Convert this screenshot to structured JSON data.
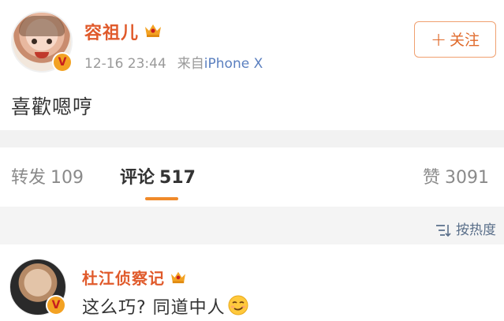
{
  "post": {
    "username": "容祖儿",
    "timestamp": "12-16 23:44",
    "source_prefix": "来自",
    "device": "iPhone X",
    "text": "喜歡嗯哼",
    "follow_label": "关注",
    "follow_plus": "+"
  },
  "tabs": [
    {
      "label": "转发",
      "count": "109"
    },
    {
      "label": "评论",
      "count": "517"
    },
    {
      "label": "赞",
      "count": "3091"
    }
  ],
  "sort_label": "按热度",
  "comment": {
    "username": "杜江侦察记",
    "text": "这么巧?  同道中人"
  },
  "icons": {
    "verified": "verified-v-badge",
    "crown": "vip-crown-icon",
    "sort": "sort-icon",
    "emoji": "smug-face-emoji"
  },
  "colors": {
    "username": "#e05a2b",
    "accent": "#f08a2a",
    "badge": "#f3a223"
  }
}
